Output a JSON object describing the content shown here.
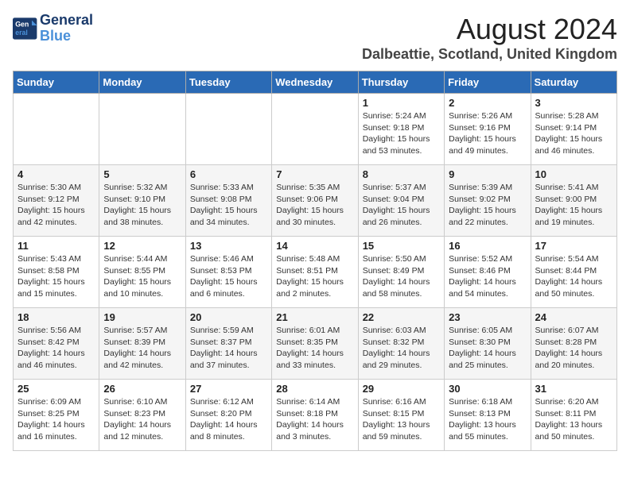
{
  "header": {
    "logo_line1": "General",
    "logo_line2": "Blue",
    "main_title": "August 2024",
    "subtitle": "Dalbeattie, Scotland, United Kingdom"
  },
  "columns": [
    "Sunday",
    "Monday",
    "Tuesday",
    "Wednesday",
    "Thursday",
    "Friday",
    "Saturday"
  ],
  "weeks": [
    [
      {
        "day": "",
        "info": ""
      },
      {
        "day": "",
        "info": ""
      },
      {
        "day": "",
        "info": ""
      },
      {
        "day": "",
        "info": ""
      },
      {
        "day": "1",
        "info": "Sunrise: 5:24 AM\nSunset: 9:18 PM\nDaylight: 15 hours\nand 53 minutes."
      },
      {
        "day": "2",
        "info": "Sunrise: 5:26 AM\nSunset: 9:16 PM\nDaylight: 15 hours\nand 49 minutes."
      },
      {
        "day": "3",
        "info": "Sunrise: 5:28 AM\nSunset: 9:14 PM\nDaylight: 15 hours\nand 46 minutes."
      }
    ],
    [
      {
        "day": "4",
        "info": "Sunrise: 5:30 AM\nSunset: 9:12 PM\nDaylight: 15 hours\nand 42 minutes."
      },
      {
        "day": "5",
        "info": "Sunrise: 5:32 AM\nSunset: 9:10 PM\nDaylight: 15 hours\nand 38 minutes."
      },
      {
        "day": "6",
        "info": "Sunrise: 5:33 AM\nSunset: 9:08 PM\nDaylight: 15 hours\nand 34 minutes."
      },
      {
        "day": "7",
        "info": "Sunrise: 5:35 AM\nSunset: 9:06 PM\nDaylight: 15 hours\nand 30 minutes."
      },
      {
        "day": "8",
        "info": "Sunrise: 5:37 AM\nSunset: 9:04 PM\nDaylight: 15 hours\nand 26 minutes."
      },
      {
        "day": "9",
        "info": "Sunrise: 5:39 AM\nSunset: 9:02 PM\nDaylight: 15 hours\nand 22 minutes."
      },
      {
        "day": "10",
        "info": "Sunrise: 5:41 AM\nSunset: 9:00 PM\nDaylight: 15 hours\nand 19 minutes."
      }
    ],
    [
      {
        "day": "11",
        "info": "Sunrise: 5:43 AM\nSunset: 8:58 PM\nDaylight: 15 hours\nand 15 minutes."
      },
      {
        "day": "12",
        "info": "Sunrise: 5:44 AM\nSunset: 8:55 PM\nDaylight: 15 hours\nand 10 minutes."
      },
      {
        "day": "13",
        "info": "Sunrise: 5:46 AM\nSunset: 8:53 PM\nDaylight: 15 hours\nand 6 minutes."
      },
      {
        "day": "14",
        "info": "Sunrise: 5:48 AM\nSunset: 8:51 PM\nDaylight: 15 hours\nand 2 minutes."
      },
      {
        "day": "15",
        "info": "Sunrise: 5:50 AM\nSunset: 8:49 PM\nDaylight: 14 hours\nand 58 minutes."
      },
      {
        "day": "16",
        "info": "Sunrise: 5:52 AM\nSunset: 8:46 PM\nDaylight: 14 hours\nand 54 minutes."
      },
      {
        "day": "17",
        "info": "Sunrise: 5:54 AM\nSunset: 8:44 PM\nDaylight: 14 hours\nand 50 minutes."
      }
    ],
    [
      {
        "day": "18",
        "info": "Sunrise: 5:56 AM\nSunset: 8:42 PM\nDaylight: 14 hours\nand 46 minutes."
      },
      {
        "day": "19",
        "info": "Sunrise: 5:57 AM\nSunset: 8:39 PM\nDaylight: 14 hours\nand 42 minutes."
      },
      {
        "day": "20",
        "info": "Sunrise: 5:59 AM\nSunset: 8:37 PM\nDaylight: 14 hours\nand 37 minutes."
      },
      {
        "day": "21",
        "info": "Sunrise: 6:01 AM\nSunset: 8:35 PM\nDaylight: 14 hours\nand 33 minutes."
      },
      {
        "day": "22",
        "info": "Sunrise: 6:03 AM\nSunset: 8:32 PM\nDaylight: 14 hours\nand 29 minutes."
      },
      {
        "day": "23",
        "info": "Sunrise: 6:05 AM\nSunset: 8:30 PM\nDaylight: 14 hours\nand 25 minutes."
      },
      {
        "day": "24",
        "info": "Sunrise: 6:07 AM\nSunset: 8:28 PM\nDaylight: 14 hours\nand 20 minutes."
      }
    ],
    [
      {
        "day": "25",
        "info": "Sunrise: 6:09 AM\nSunset: 8:25 PM\nDaylight: 14 hours\nand 16 minutes."
      },
      {
        "day": "26",
        "info": "Sunrise: 6:10 AM\nSunset: 8:23 PM\nDaylight: 14 hours\nand 12 minutes."
      },
      {
        "day": "27",
        "info": "Sunrise: 6:12 AM\nSunset: 8:20 PM\nDaylight: 14 hours\nand 8 minutes."
      },
      {
        "day": "28",
        "info": "Sunrise: 6:14 AM\nSunset: 8:18 PM\nDaylight: 14 hours\nand 3 minutes."
      },
      {
        "day": "29",
        "info": "Sunrise: 6:16 AM\nSunset: 8:15 PM\nDaylight: 13 hours\nand 59 minutes."
      },
      {
        "day": "30",
        "info": "Sunrise: 6:18 AM\nSunset: 8:13 PM\nDaylight: 13 hours\nand 55 minutes."
      },
      {
        "day": "31",
        "info": "Sunrise: 6:20 AM\nSunset: 8:11 PM\nDaylight: 13 hours\nand 50 minutes."
      }
    ]
  ]
}
